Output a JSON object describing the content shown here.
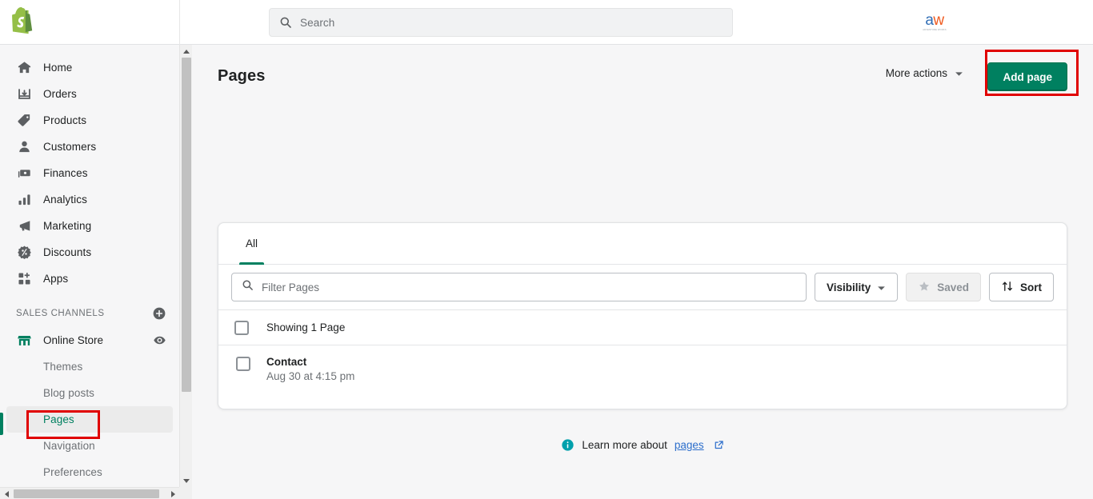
{
  "topbar": {
    "logo_name": "shopify-logo",
    "search": {
      "placeholder": "Search",
      "icon": "search-icon"
    },
    "brand": {
      "letter_a": "a",
      "letter_w": "w",
      "subtext": "ADVENTURE WORKS"
    }
  },
  "sidebar": {
    "nav": [
      {
        "label": "Home",
        "icon": "home-icon"
      },
      {
        "label": "Orders",
        "icon": "orders-icon"
      },
      {
        "label": "Products",
        "icon": "tag-icon"
      },
      {
        "label": "Customers",
        "icon": "person-icon"
      },
      {
        "label": "Finances",
        "icon": "cash-icon"
      },
      {
        "label": "Analytics",
        "icon": "bar-chart-icon"
      },
      {
        "label": "Marketing",
        "icon": "megaphone-icon"
      },
      {
        "label": "Discounts",
        "icon": "discount-icon"
      },
      {
        "label": "Apps",
        "icon": "apps-icon"
      }
    ],
    "section": {
      "label": "SALES CHANNELS",
      "add_icon": "plus-circle-icon"
    },
    "channel": {
      "label": "Online Store",
      "icon": "storefront-icon",
      "view_icon": "eye-icon"
    },
    "sub_items": [
      {
        "label": "Themes",
        "active": false
      },
      {
        "label": "Blog posts",
        "active": false
      },
      {
        "label": "Pages",
        "active": true
      },
      {
        "label": "Navigation",
        "active": false
      },
      {
        "label": "Preferences",
        "active": false
      }
    ]
  },
  "main": {
    "title": "Pages",
    "more_actions": {
      "label": "More actions",
      "icon": "chevron-down-icon"
    },
    "add_page": {
      "label": "Add page"
    },
    "tabs": [
      {
        "label": "All",
        "active": true
      }
    ],
    "filter": {
      "placeholder": "Filter Pages",
      "icon": "search-icon",
      "visibility": {
        "label": "Visibility",
        "icon": "chevron-down-icon"
      },
      "saved": {
        "label": "Saved",
        "icon": "star-icon",
        "disabled": true
      },
      "sort": {
        "label": "Sort",
        "icon": "sort-arrows-icon"
      }
    },
    "showing": "Showing 1 Page",
    "rows": [
      {
        "title": "Contact",
        "subtitle": "Aug 30 at 4:15 pm"
      }
    ],
    "footer": {
      "info_icon": "info-icon",
      "text": "Learn more about",
      "link": "pages",
      "external_icon": "external-link-icon"
    }
  },
  "colors": {
    "accent_green": "#008060",
    "annotation_red": "#e00000",
    "link_blue": "#2c6ecb",
    "info_teal": "#00a0ac"
  }
}
